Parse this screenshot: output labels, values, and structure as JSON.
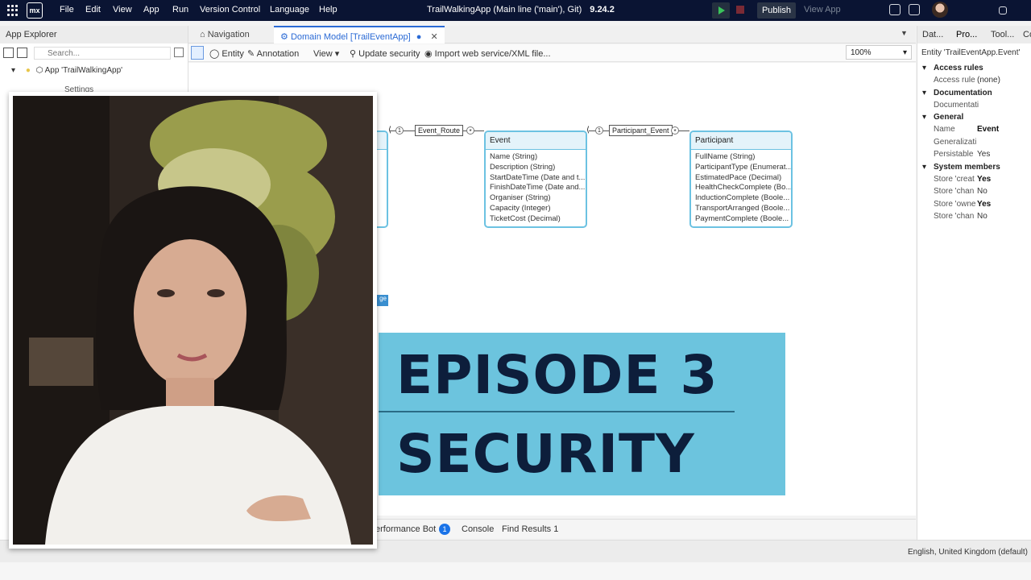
{
  "topbar": {
    "menu": [
      "File",
      "Edit",
      "View",
      "App",
      "Run",
      "Version Control",
      "Language",
      "Help"
    ],
    "logo_text": "mx",
    "title": "TrailWalkingApp (Main line ('main'), Git)",
    "version": "9.24.2",
    "publish_label": "Publish",
    "view_app_label": "View App"
  },
  "app_explorer": {
    "header": "App Explorer",
    "search_placeholder": "Search...",
    "tree_app": "App 'TrailWalkingApp'",
    "tree_settings": "Settings"
  },
  "tabs": {
    "navigation": "Navigation",
    "domain_model": "Domain Model [TrailEventApp]"
  },
  "toolbar": {
    "entity": "Entity",
    "annotation": "Annotation",
    "view": "View",
    "update_security": "Update security",
    "import_ws": "Import web service/XML file...",
    "zoom": "100%"
  },
  "canvas": {
    "assoc_event_route": "Event_Route",
    "assoc_participant_event": "Participant_Event",
    "mult_one": "1",
    "mult_many": "*",
    "partial_badge": "ge",
    "event": {
      "name": "Event",
      "attributes": [
        "Name (String)",
        "Description (String)",
        "StartDateTime (Date and t...",
        "FinishDateTime (Date and...",
        "Organiser (String)",
        "Capacity (Integer)",
        "TicketCost (Decimal)"
      ]
    },
    "participant": {
      "name": "Participant",
      "attributes": [
        "FullName (String)",
        "ParticipantType (Enumerat...",
        "EstimatedPace (Decimal)",
        "HealthCheckComplete (Bo...",
        "InductionComplete (Boole...",
        "TransportArranged (Boole...",
        "PaymentComplete (Boole..."
      ]
    }
  },
  "right_panel": {
    "tabs": [
      "Dat...",
      "Pro...",
      "Tool...",
      "Co"
    ],
    "entity_title": "Entity 'TrailEventApp.Event'",
    "access_rules": "Access rules",
    "access_rule_label": "Access rule",
    "access_rule_value": "(none)",
    "documentation": "Documentation",
    "documentation_label": "Documentati",
    "general": "General",
    "name_label": "Name",
    "name_value": "Event",
    "generalization_label": "Generalizati",
    "persistable_label": "Persistable",
    "persistable_value": "Yes",
    "system_members": "System members",
    "store_created_label": "Store 'creat",
    "store_created_value": "Yes",
    "store_changed_label": "Store 'chan",
    "store_changed_value": "No",
    "store_owner_label": "Store 'owne",
    "store_owner_value": "Yes",
    "store_changedby_label": "Store 'chan",
    "store_changedby_value": "No"
  },
  "bottom": {
    "performance_bot": "erformance Bot",
    "badge": "1",
    "console": "Console",
    "find_results": "Find Results 1",
    "language": "English, United Kingdom (default)"
  },
  "banner": {
    "line1": "EPISODE 3",
    "line2": "SECURITY",
    "color": "#6cc4de",
    "text_color": "#0d1e3b"
  }
}
